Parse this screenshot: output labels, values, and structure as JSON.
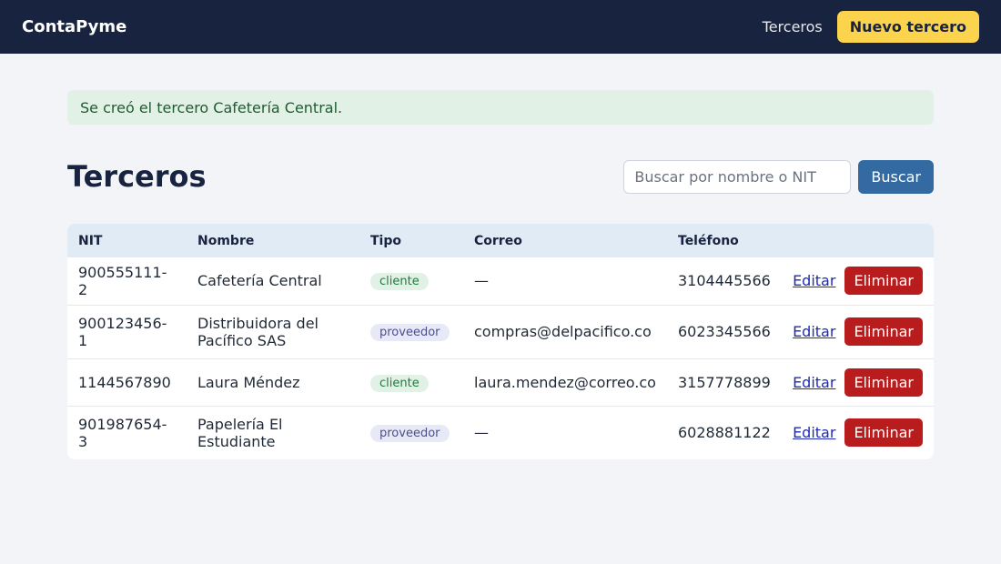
{
  "navbar": {
    "brand": "ContaPyme",
    "link_terceros": "Terceros",
    "new_button": "Nuevo tercero"
  },
  "alert": {
    "message": "Se creó el tercero Cafetería Central."
  },
  "page": {
    "title": "Terceros"
  },
  "search": {
    "placeholder": "Buscar por nombre o NIT",
    "value": "",
    "button": "Buscar"
  },
  "table": {
    "headers": [
      "NIT",
      "Nombre",
      "Tipo",
      "Correo",
      "Teléfono"
    ],
    "edit_label": "Editar",
    "delete_label": "Eliminar",
    "rows": [
      {
        "nit": "900555111-2",
        "nombre": "Cafetería Central",
        "tipo": "cliente",
        "correo": "—",
        "telefono": "3104445566"
      },
      {
        "nit": "900123456-1",
        "nombre": "Distribuidora del Pacífico SAS",
        "tipo": "proveedor",
        "correo": "compras@delpacifico.co",
        "telefono": "6023345566"
      },
      {
        "nit": "1144567890",
        "nombre": "Laura Méndez",
        "tipo": "cliente",
        "correo": "laura.mendez@correo.co",
        "telefono": "3157778899"
      },
      {
        "nit": "901987654-3",
        "nombre": "Papelería El Estudiante",
        "tipo": "proveedor",
        "correo": "—",
        "telefono": "6028881122"
      }
    ]
  },
  "colors": {
    "navbar_bg": "#17233f",
    "accent_yellow": "#fcd34d",
    "primary_blue": "#326aa1",
    "danger_red": "#b91c1c",
    "success_bg": "#e1f1e5"
  }
}
